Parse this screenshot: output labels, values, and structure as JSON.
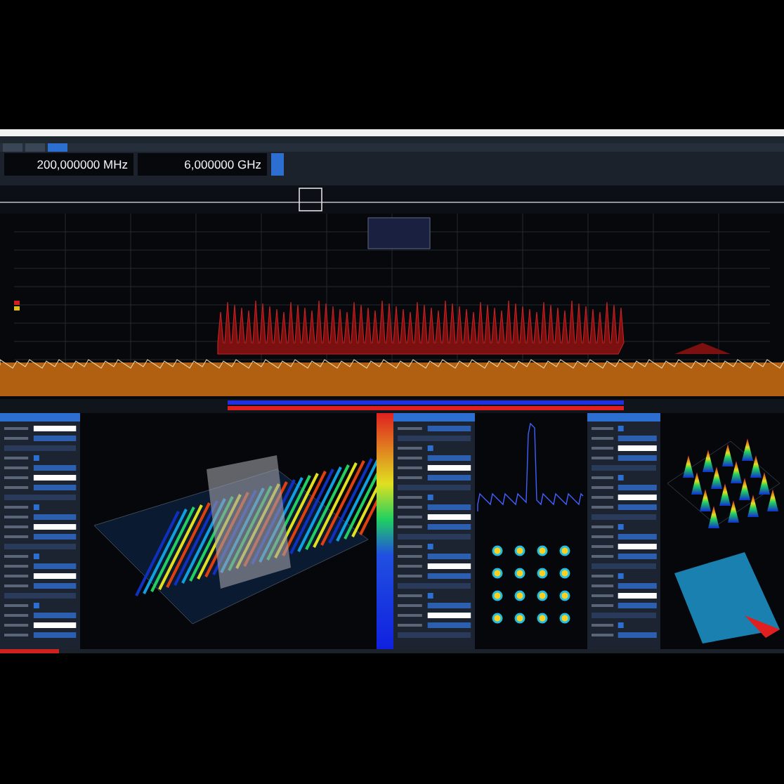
{
  "tabs": [
    {
      "selected": false
    },
    {
      "selected": false
    },
    {
      "selected": true
    }
  ],
  "frequency_bar": {
    "start": "200,000000 MHz",
    "stop": "6,000000 GHz"
  }
}
